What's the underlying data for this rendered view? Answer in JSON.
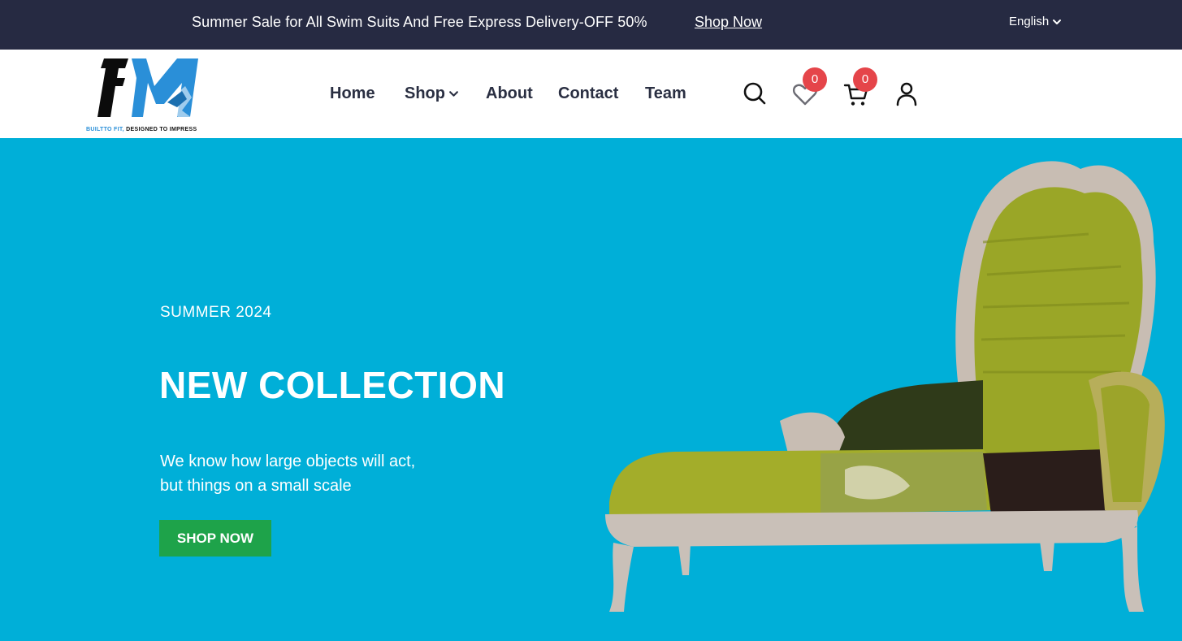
{
  "topbar": {
    "promo_text": "Summer Sale for All Swim Suits And Free Express Delivery-OFF 50%",
    "promo_link": "Shop Now",
    "language": "English",
    "background": "#262a42"
  },
  "logo": {
    "letters": "FM",
    "tagline_part1": "BUILTTO FIT,",
    "tagline_part2": "DESIGNED TO IMPRESS"
  },
  "nav": {
    "items": [
      {
        "label": "Home"
      },
      {
        "label": "Shop",
        "has_dropdown": true
      },
      {
        "label": "About"
      },
      {
        "label": "Contact"
      },
      {
        "label": "Team"
      }
    ]
  },
  "header_icons": {
    "search": "search-icon",
    "wishlist": {
      "icon": "heart-icon",
      "count": "0"
    },
    "cart": {
      "icon": "cart-icon",
      "count": "0"
    },
    "account": "user-icon",
    "badge_color": "#e5454a"
  },
  "hero": {
    "season": "SUMMER 2024",
    "title": "NEW COLLECTION",
    "description_line1": "We know how large objects will act,",
    "description_line2": "but things on a small scale",
    "button": "SHOP NOW",
    "background": "#00afd8",
    "button_color": "#1ea34a"
  }
}
